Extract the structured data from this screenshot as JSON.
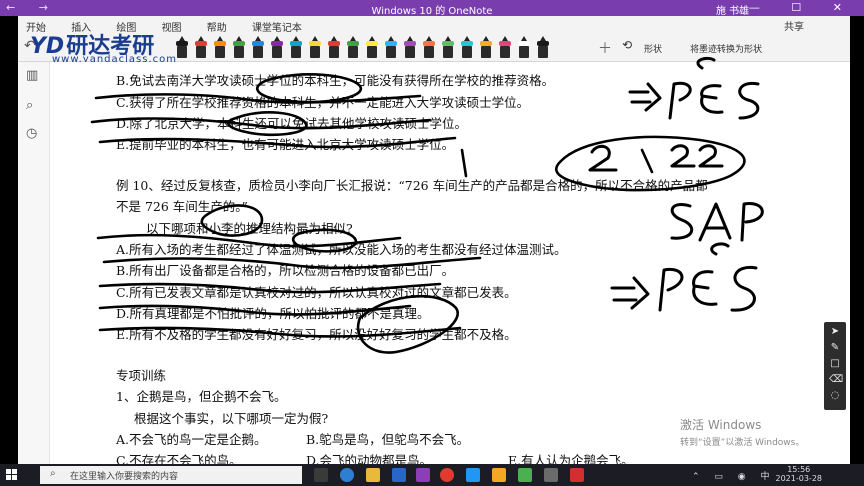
{
  "window": {
    "title": "Windows 10 的 OneNote",
    "user": "施 书雄",
    "nav": "← →",
    "controls": "— ☐ ✕"
  },
  "ribbon": {
    "menus": [
      "开始",
      "插入",
      "绘图",
      "视图",
      "帮助",
      "课堂笔记本"
    ],
    "share_label": "共享",
    "shapes_label": "形状",
    "ink_to_shape_label": "将墨迹转换为形状",
    "pen_colors": [
      "#1a1a1a",
      "#e53935",
      "#fb8c00",
      "#43a047",
      "#1e88e5",
      "#8e24aa",
      "#00acc1",
      "#fdd835",
      "#e53935",
      "#43a047",
      "#ffeb3b",
      "#29b6f6",
      "#ab47bc",
      "#ff7043",
      "#66bb6a",
      "#26c6da",
      "#ffa726",
      "#ec407a",
      "#ffffff",
      "#1a1a1a"
    ]
  },
  "logo": {
    "mark": "YD",
    "name": "研达考研",
    "url": "www.yandaclass.com"
  },
  "document": {
    "lines": [
      "B.免试去南洋大学攻读硕士学位的本科生，可能没有获得所在学校的推荐资格。",
      "C.获得了所在学校推荐资格的本科生，并不一定能进入大学攻读硕士学位。",
      "D.除了北京大学，本科生还可以免试去其他学校攻读硕士学位。",
      "E.提前毕业的本科生，也有可能进入北京大学攻读硕士学位。",
      "例 10、经过反复核查，质检员小李向厂长汇报说：“726 车间生产的产品都是合格的，所以不合格的产品都",
      "不是 726 车间生产的。”",
      "以下哪项和小李的推理结构最为相似?",
      "A.所有入场的考生都经过了体温测试，所以没能入场的考生都没有经过体温测试。",
      "B.所有出厂设备都是合格的，所以检测合格的设备都已出厂。",
      "C.所有已发表文章都是认真校对过的，所以认真校对过的文章都已发表。",
      "D.所有真理都是不怕批评的，所以怕批评的都不是真理。",
      "E.所有不及格的学生都没有好好复习，所以没好好复习的学生都不及格。",
      "专项训练",
      "1、企鹅是鸟，但企鹅不会飞。",
      "根据这个事实，以下哪项一定为假?"
    ],
    "options_row1": [
      "A.不会飞的鸟一定是企鹅。",
      "B.鸵鸟是鸟，但鸵鸟不会飞。"
    ],
    "options_row2": [
      "C.不存在不会飞的鸟。",
      "D.会飞的动物都是鸟。",
      "E.有人认为企鹅会飞。"
    ]
  },
  "activation": {
    "title": "激活 Windows",
    "detail": "转到“设置”以激活 Windows。"
  },
  "taskbar": {
    "search_placeholder": "在这里输入你要搜索的内容",
    "time": "15:56",
    "date": "2021-03-28",
    "ime": "中"
  }
}
